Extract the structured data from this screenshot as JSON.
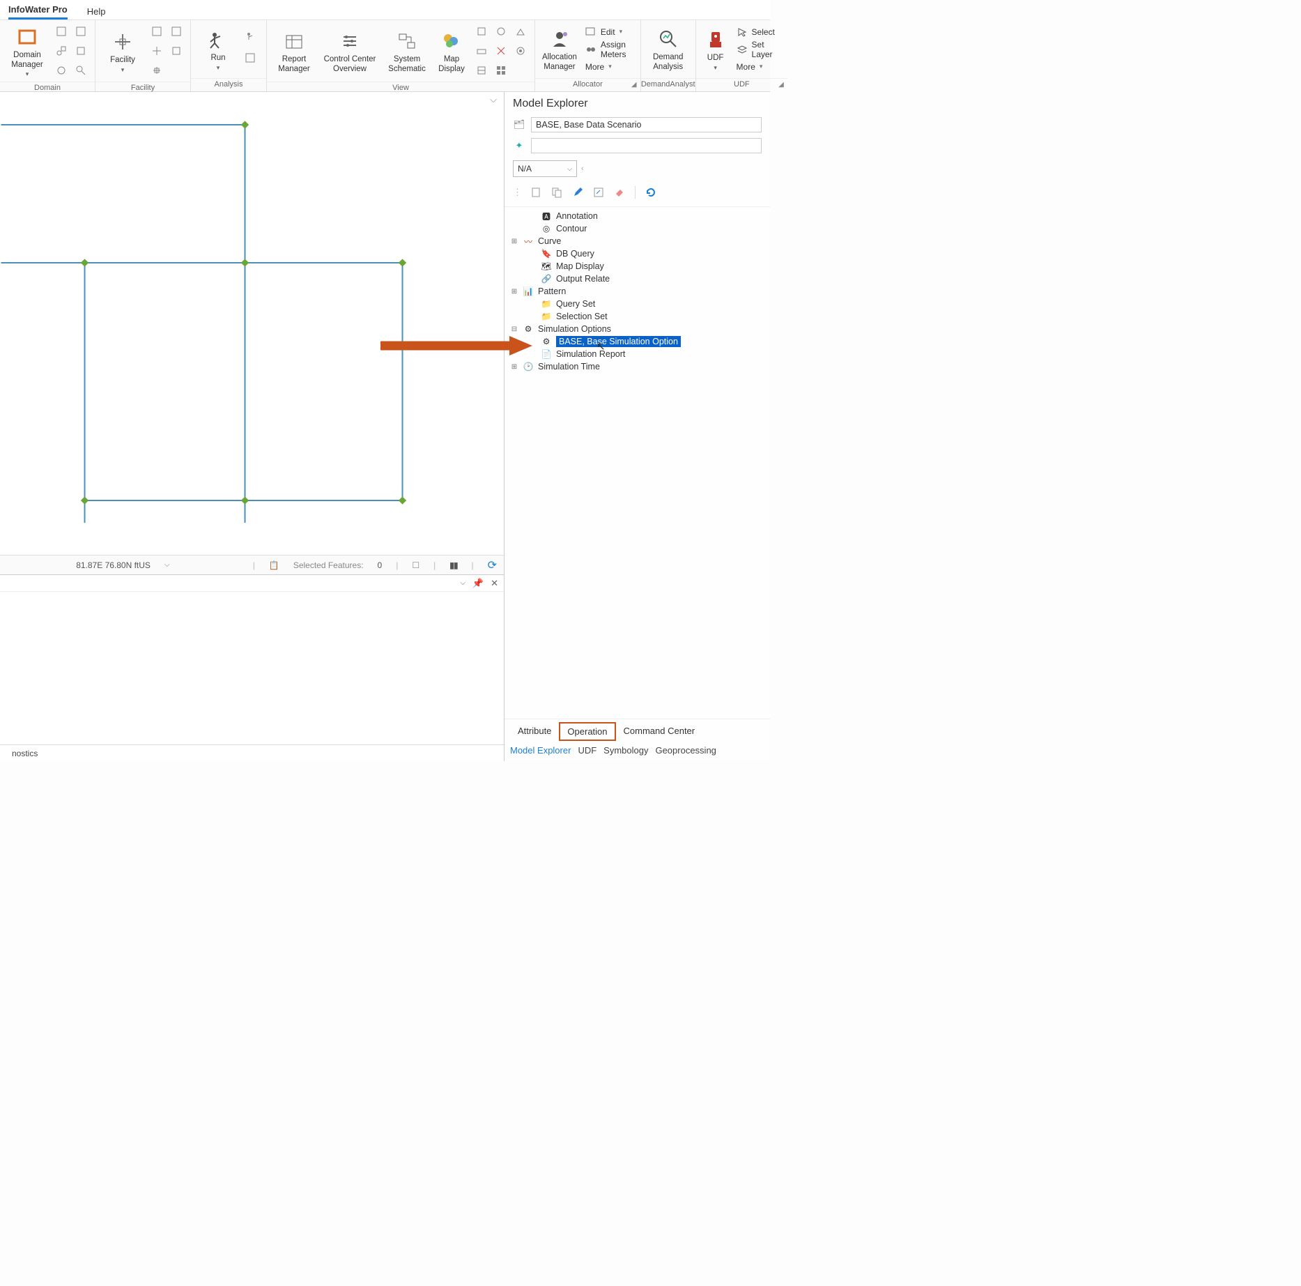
{
  "menu": {
    "tab1": "InfoWater Pro",
    "tab2": "Help"
  },
  "ribbon": {
    "domain": {
      "title": "Domain",
      "button": "Domain\nManager"
    },
    "facility": {
      "title": "Facility",
      "button": "Facility"
    },
    "analysis": {
      "title": "Analysis",
      "button": "Run"
    },
    "view": {
      "title": "View",
      "report": "Report\nManager",
      "control": "Control Center\nOverview",
      "system": "System\nSchematic",
      "map": "Map\nDisplay"
    },
    "allocator": {
      "title": "Allocator",
      "button": "Allocation\nManager",
      "edit": "Edit",
      "assign": "Assign Meters",
      "more": "More"
    },
    "demand": {
      "title": "DemandAnalyst",
      "button": "Demand\nAnalysis"
    },
    "udf": {
      "title": "UDF",
      "button": "UDF",
      "select": "Select",
      "setlayer": "Set Layer",
      "more": "More"
    }
  },
  "map_status": {
    "coords": "81.87E 76.80N ftUS",
    "selected_label": "Selected Features:",
    "selected_count": "0"
  },
  "dock": {
    "tab": "nostics"
  },
  "explorer": {
    "title": "Model Explorer",
    "scenario": "BASE, Base Data Scenario",
    "combo_value": "N/A",
    "tree": {
      "annotation": "Annotation",
      "contour": "Contour",
      "curve": "Curve",
      "dbquery": "DB Query",
      "mapdisplay": "Map Display",
      "outputrelate": "Output Relate",
      "pattern": "Pattern",
      "queryset": "Query Set",
      "selectionset": "Selection Set",
      "simoptions": "Simulation Options",
      "simoptions_child": "BASE, Base Simulation Option",
      "simreport": "Simulation Report",
      "simtime": "Simulation Time"
    }
  },
  "footer1": {
    "attribute": "Attribute",
    "operation": "Operation",
    "command": "Command Center"
  },
  "footer2": {
    "model": "Model Explorer",
    "udf": "UDF",
    "symbology": "Symbology",
    "geoprocessing": "Geoprocessing"
  }
}
